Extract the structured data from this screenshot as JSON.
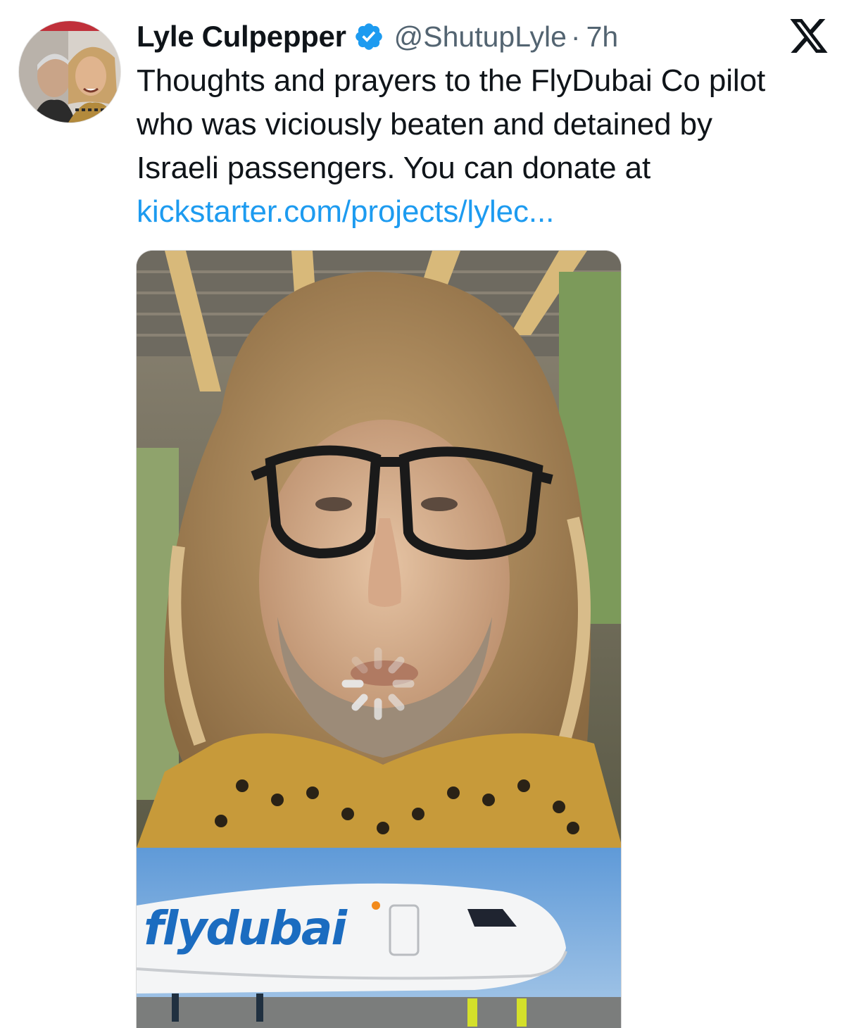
{
  "author": {
    "display_name": "Lyle Culpepper",
    "handle": "@ShutupLyle",
    "separator": "·",
    "timestamp": "7h",
    "verified_icon": "verified-badge-icon",
    "avatar_icon": "avatar"
  },
  "platform": {
    "logo_icon": "x-logo-icon"
  },
  "tweet": {
    "lines": [
      "Thoughts and prayers to the FlyDubai Co pilot",
      "who was viciously beaten and detained by",
      "Israeli passengers. You can donate at"
    ],
    "link_text": "kickstarter.com/projects/lylec..."
  },
  "media": {
    "brand_text": "flydubai",
    "loading_icon": "loading-spinner-icon"
  },
  "colors": {
    "link": "#1d9bf0",
    "verified": "#1d9bf0",
    "secondary_text": "#536471",
    "primary_text": "#0f1419",
    "flydubai_blue": "#1b6cc0",
    "flydubai_orange": "#f28a1c"
  }
}
